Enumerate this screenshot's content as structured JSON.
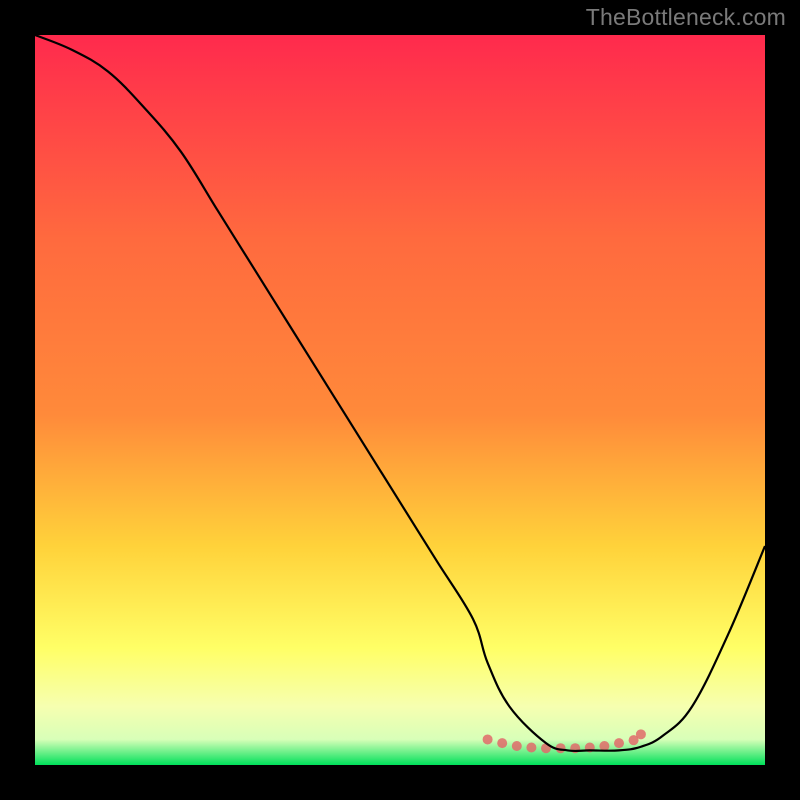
{
  "watermark": "TheBottleneck.com",
  "chart_data": {
    "type": "line",
    "title": "",
    "xlabel": "",
    "ylabel": "",
    "xlim": [
      0,
      100
    ],
    "ylim": [
      0,
      100
    ],
    "grid": false,
    "legend": false,
    "gradient_colors": {
      "top": "#ff2a4d",
      "mid_upper": "#ff8a3a",
      "mid": "#ffd23a",
      "mid_lower": "#ffff66",
      "near_bottom": "#f6ffb0",
      "bottom": "#00e05a"
    },
    "series": [
      {
        "name": "bottleneck-curve",
        "color": "#000000",
        "stroke_width": 2.2,
        "x": [
          0,
          5,
          10,
          15,
          20,
          25,
          30,
          35,
          40,
          45,
          50,
          55,
          60,
          62,
          65,
          70,
          73,
          76,
          80,
          83,
          86,
          90,
          95,
          100
        ],
        "y": [
          100,
          98,
          95,
          90,
          84,
          76,
          68,
          60,
          52,
          44,
          36,
          28,
          20,
          14,
          8,
          3,
          2,
          2,
          2,
          2.5,
          4,
          8,
          18,
          30
        ]
      },
      {
        "name": "highlight-dots",
        "color": "#e06a6a",
        "marker_radius": 5,
        "style": "dots",
        "x": [
          62,
          64,
          66,
          68,
          70,
          72,
          74,
          76,
          78,
          80,
          82,
          83
        ],
        "y": [
          3.5,
          3,
          2.6,
          2.4,
          2.3,
          2.3,
          2.3,
          2.4,
          2.6,
          3,
          3.4,
          4.2
        ]
      }
    ],
    "annotations": []
  }
}
